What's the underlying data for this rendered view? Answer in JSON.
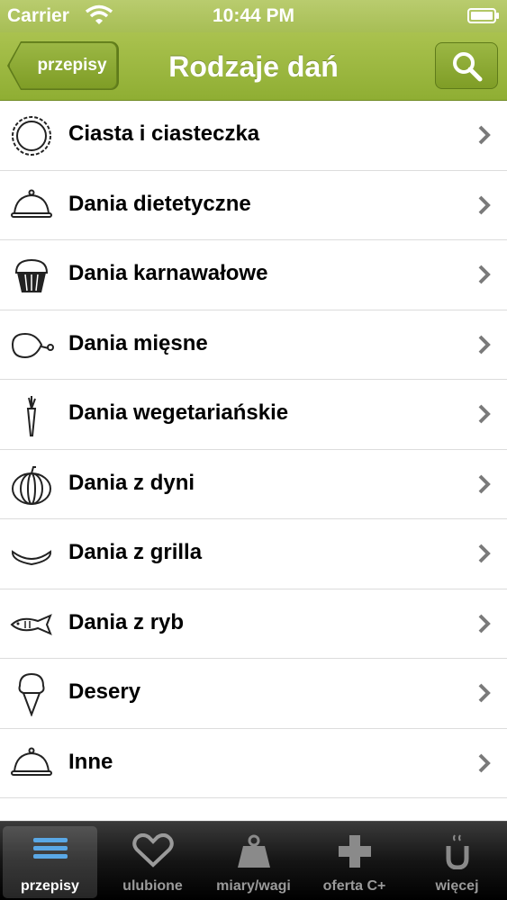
{
  "status_bar": {
    "carrier": "Carrier",
    "time": "10:44 PM"
  },
  "nav": {
    "back_label": "przepisy",
    "title": "Rodzaje dań",
    "search_icon": "search-icon"
  },
  "list": [
    {
      "label": "Ciasta i ciasteczka",
      "icon": "tart-icon"
    },
    {
      "label": "Dania dietetyczne",
      "icon": "cloche-icon"
    },
    {
      "label": "Dania karnawałowe",
      "icon": "cupcake-icon"
    },
    {
      "label": "Dania mięsne",
      "icon": "ham-icon"
    },
    {
      "label": "Dania wegetariańskie",
      "icon": "carrot-icon"
    },
    {
      "label": "Dania z dyni",
      "icon": "pumpkin-icon"
    },
    {
      "label": "Dania z grilla",
      "icon": "sausage-icon"
    },
    {
      "label": "Dania z ryb",
      "icon": "fish-icon"
    },
    {
      "label": "Desery",
      "icon": "ice-cream-icon"
    },
    {
      "label": "Inne",
      "icon": "cloche-icon"
    },
    {
      "label": "",
      "icon": ""
    }
  ],
  "tabs": [
    {
      "label": "przepisy",
      "icon": "list-icon",
      "active": true
    },
    {
      "label": "ulubione",
      "icon": "heart-icon"
    },
    {
      "label": "miary/wagi",
      "icon": "weight-icon"
    },
    {
      "label": "oferta C+",
      "icon": "plus-icon"
    },
    {
      "label": "więcej",
      "icon": "magnet-icon"
    }
  ],
  "colors": {
    "nav_green": "#9bb744",
    "tab_bar": "#151515"
  }
}
